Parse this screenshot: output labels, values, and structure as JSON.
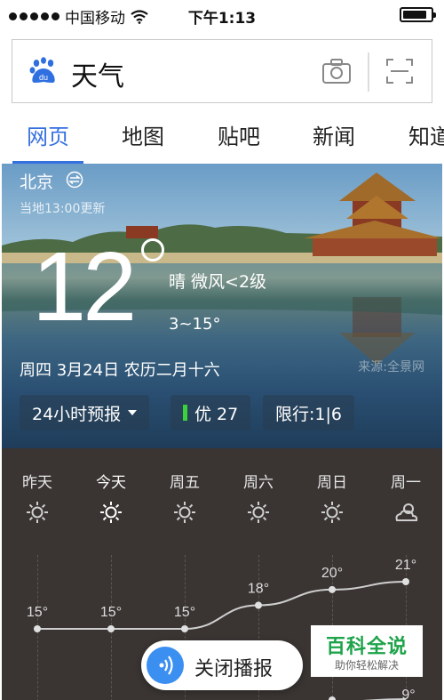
{
  "status_bar": {
    "carrier": "中国移动",
    "time": "下午1:13",
    "battery_level": 0.85
  },
  "search": {
    "query": "天气",
    "logo_text": "du"
  },
  "tabs": [
    {
      "label": "网页",
      "active": true
    },
    {
      "label": "地图",
      "active": false
    },
    {
      "label": "贴吧",
      "active": false
    },
    {
      "label": "新闻",
      "active": false
    },
    {
      "label": "知道",
      "active": false
    }
  ],
  "weather": {
    "city": "北京",
    "update_time": "当地13:00更新",
    "temperature": "12",
    "condition": "晴  微风<2级",
    "range": "3~15°",
    "date_line": "周四 3月24日  农历二月十六",
    "photo_credit": "来源:全景网",
    "forecast_button": "24小时预报",
    "aqi": "优 27",
    "restriction": "限行:1|6"
  },
  "forecast": {
    "days": [
      "昨天",
      "今天",
      "周五",
      "周六",
      "周日",
      "周一"
    ],
    "icons": [
      "sun-icon",
      "sun-icon",
      "sun-icon",
      "sun-icon",
      "sun-icon",
      "partly-cloudy-icon"
    ]
  },
  "chart_data": {
    "type": "line",
    "categories": [
      "昨天",
      "今天",
      "周五",
      "周六",
      "周日",
      "周一"
    ],
    "series": [
      {
        "values": [
          15,
          15,
          15,
          18,
          20,
          21
        ]
      },
      {
        "values": [
          null,
          null,
          null,
          null,
          null,
          9
        ]
      }
    ],
    "labels": [
      "15°",
      "15°",
      "15°",
      "18°",
      "20°",
      "21°"
    ],
    "low_labels_visible": [
      "9°"
    ]
  },
  "floating": {
    "audio_label": "关闭播报",
    "baike_title": "百科全说",
    "baike_subtitle": "助你轻松解决"
  }
}
